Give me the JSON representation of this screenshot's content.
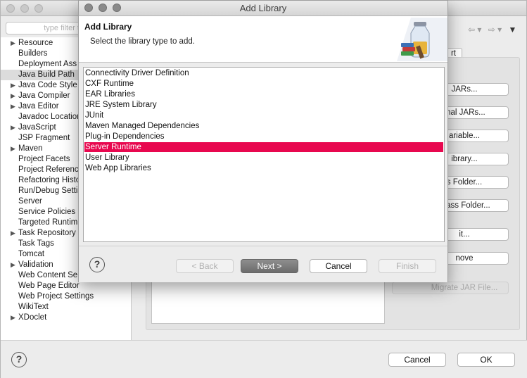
{
  "background_window": {
    "filter_placeholder": "type filter t",
    "tree_items": [
      {
        "label": "Resource",
        "expandable": true
      },
      {
        "label": "Builders",
        "expandable": false
      },
      {
        "label": "Deployment Ass",
        "expandable": false
      },
      {
        "label": "Java Build Path",
        "expandable": false,
        "selected": true
      },
      {
        "label": "Java Code Style",
        "expandable": true
      },
      {
        "label": "Java Compiler",
        "expandable": true
      },
      {
        "label": "Java Editor",
        "expandable": true
      },
      {
        "label": "Javadoc Location",
        "expandable": false
      },
      {
        "label": "JavaScript",
        "expandable": true
      },
      {
        "label": "JSP Fragment",
        "expandable": false
      },
      {
        "label": "Maven",
        "expandable": true
      },
      {
        "label": "Project Facets",
        "expandable": false
      },
      {
        "label": "Project Referenc",
        "expandable": false
      },
      {
        "label": "Refactoring Histo",
        "expandable": false
      },
      {
        "label": "Run/Debug Setti",
        "expandable": false
      },
      {
        "label": "Server",
        "expandable": false
      },
      {
        "label": "Service Policies",
        "expandable": false
      },
      {
        "label": "Targeted Runtim",
        "expandable": false
      },
      {
        "label": "Task Repository",
        "expandable": true
      },
      {
        "label": "Task Tags",
        "expandable": false
      },
      {
        "label": "Tomcat",
        "expandable": false
      },
      {
        "label": "Validation",
        "expandable": true
      },
      {
        "label": "Web Content Se",
        "expandable": false
      },
      {
        "label": "Web Page Editor",
        "expandable": false
      },
      {
        "label": "Web Project Settings",
        "expandable": false
      },
      {
        "label": "WikiText",
        "expandable": false
      },
      {
        "label": "XDoclet",
        "expandable": true
      }
    ],
    "tab_fragment": "rt",
    "side_buttons": [
      {
        "label": "JARs...",
        "enabled": true
      },
      {
        "label": "rnal JARs...",
        "enabled": true
      },
      {
        "label": "ariable...",
        "enabled": true
      },
      {
        "label": "ibrary...",
        "enabled": true
      },
      {
        "label": "s Folder...",
        "enabled": true
      },
      {
        "label": "Class Folder...",
        "enabled": true
      },
      {
        "label": "it...",
        "enabled": true
      },
      {
        "label": "nove",
        "enabled": true
      },
      {
        "label": "Migrate JAR File...",
        "enabled": false
      }
    ],
    "nav_back": "⇦ ▾",
    "nav_forward": "⇨ ▾",
    "view_menu": "▼",
    "help": "?",
    "cancel_label": "Cancel",
    "ok_label": "OK"
  },
  "dialog": {
    "title": "Add Library",
    "heading": "Add Library",
    "description": "Select the library type to add.",
    "libraries": [
      {
        "label": "Connectivity Driver Definition",
        "selected": false
      },
      {
        "label": "CXF Runtime",
        "selected": false
      },
      {
        "label": "EAR Libraries",
        "selected": false
      },
      {
        "label": "JRE System Library",
        "selected": false
      },
      {
        "label": "JUnit",
        "selected": false
      },
      {
        "label": "Maven Managed Dependencies",
        "selected": false
      },
      {
        "label": "Plug-in Dependencies",
        "selected": false
      },
      {
        "label": "Server Runtime",
        "selected": true
      },
      {
        "label": "User Library",
        "selected": false
      },
      {
        "label": "Web App Libraries",
        "selected": false
      }
    ],
    "help": "?",
    "back_label": "< Back",
    "next_label": "Next >",
    "cancel_label": "Cancel",
    "finish_label": "Finish"
  },
  "colors": {
    "selection": "#e8084f",
    "default_button": "#7a7a7a"
  }
}
